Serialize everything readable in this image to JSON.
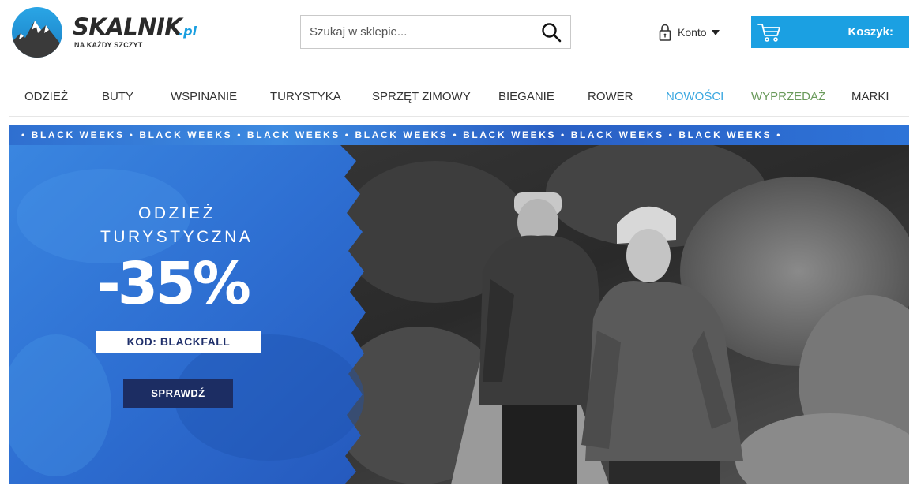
{
  "header": {
    "logo_name": "SKALNIK",
    "logo_suffix": ".pl",
    "logo_tagline": "NA KAŻDY SZCZYT",
    "search_placeholder": "Szukaj w sklepie...",
    "account_label": "Konto",
    "cart_label": "Koszyk:"
  },
  "nav": {
    "items": [
      {
        "label": "ODZIEŻ",
        "color": "#333333"
      },
      {
        "label": "BUTY",
        "color": "#333333"
      },
      {
        "label": "WSPINANIE",
        "color": "#333333"
      },
      {
        "label": "TURYSTYKA",
        "color": "#333333"
      },
      {
        "label": "SPRZĘT ZIMOWY",
        "color": "#333333"
      },
      {
        "label": "BIEGANIE",
        "color": "#333333"
      },
      {
        "label": "ROWER",
        "color": "#333333"
      },
      {
        "label": "NOWOŚCI",
        "color": "#3aa7e0"
      },
      {
        "label": "WYPRZEDAŻ",
        "color": "#6a9a5b"
      },
      {
        "label": "MARKI",
        "color": "#333333"
      }
    ]
  },
  "banner": {
    "ticker": "• BLACK WEEKS • BLACK WEEKS • BLACK WEEKS • BLACK WEEKS • BLACK WEEKS • BLACK WEEKS • BLACK WEEKS •",
    "heading_line1": "ODZIEŻ",
    "heading_line2": "TURYSTYCZNA",
    "discount": "-35%",
    "code": "KOD: BLACKFALL",
    "cta": "SPRAWDŹ"
  },
  "colors": {
    "brand_blue": "#1ba0e2",
    "panel_blue": "#2f6fd0",
    "cta_navy": "#1c2d63"
  },
  "icons": {
    "logo": "mountain-logo-icon",
    "search": "search-icon",
    "account": "lock-icon",
    "account_caret": "caret-down-icon",
    "cart": "cart-icon"
  }
}
